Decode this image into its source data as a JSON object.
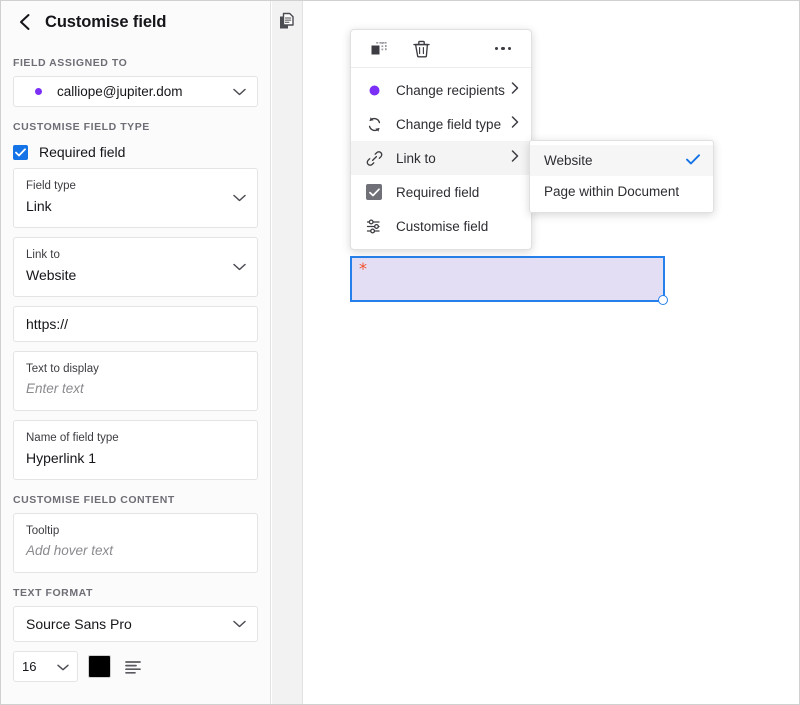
{
  "colors": {
    "accent_blue": "#2680eb",
    "check_blue": "#1473e6",
    "recipient_purple": "#7b2ff7",
    "field_fill": "#e4def5",
    "asterisk_red": "#f2512b",
    "swatch_black": "#000000",
    "menu_check_gray": "#707078"
  },
  "sidebar": {
    "back_icon": "back-chevron-icon",
    "title": "Customise field",
    "section_assigned": "FIELD ASSIGNED TO",
    "recipient": {
      "email": "calliope@jupiter.dom",
      "dot_icon": "recipient-dot-icon",
      "chevron_icon": "chevron-down-icon"
    },
    "section_field_type": "CUSTOMISE FIELD TYPE",
    "required_field": {
      "label": "Required field",
      "checked": true,
      "icon": "checkbox-checked-icon"
    },
    "fields": [
      {
        "label": "Field type",
        "value": "Link",
        "has_chevron": true
      },
      {
        "label": "Link to",
        "value": "Website",
        "has_chevron": true
      },
      {
        "label": "",
        "value": "https://",
        "has_chevron": false
      },
      {
        "label": "Text to display",
        "placeholder": "Enter text",
        "has_chevron": false
      },
      {
        "label": "Name of field type",
        "value": "Hyperlink 1",
        "has_chevron": false
      }
    ],
    "section_field_content": "CUSTOMISE FIELD CONTENT",
    "tooltip": {
      "label": "Tooltip",
      "placeholder": "Add hover text"
    },
    "section_text_format": "TEXT FORMAT",
    "font": {
      "value": "Source Sans Pro",
      "chevron_icon": "chevron-down-icon"
    },
    "font_size": {
      "value": "16",
      "chevron_icon": "chevron-down-icon"
    },
    "color_swatch": {
      "name": "text-colour-swatch",
      "value": "#000000"
    },
    "align": {
      "name": "align-left-icon"
    }
  },
  "rail": {
    "icon": "page-thumbnails-icon"
  },
  "document": {
    "form_field": {
      "name": "link-form-field",
      "asterisk": "*",
      "resize_handle": "resize-handle"
    }
  },
  "context_menu": {
    "toolbar": [
      {
        "name": "duplicate-field-icon",
        "label": "Duplicate field"
      },
      {
        "name": "delete-field-icon",
        "label": "Delete field"
      },
      {
        "name": "more-options-icon",
        "label": "More options"
      }
    ],
    "items": [
      {
        "label": "Change recipients",
        "icon": "recipient-dot-icon",
        "arrow": true,
        "active": false
      },
      {
        "label": "Change field type",
        "icon": "change-field-type-icon",
        "arrow": true,
        "active": false
      },
      {
        "label": "Link to",
        "icon": "link-icon",
        "arrow": true,
        "active": true
      },
      {
        "label": "Required field",
        "icon": "checkbox-checked-icon",
        "arrow": false,
        "active": false
      },
      {
        "label": "Customise field",
        "icon": "settings-sliders-icon",
        "arrow": false,
        "active": false
      }
    ]
  },
  "submenu": {
    "items": [
      {
        "label": "Website",
        "selected": true,
        "check_icon": "check-icon"
      },
      {
        "label": "Page within Document",
        "selected": false,
        "check_icon": ""
      }
    ]
  }
}
